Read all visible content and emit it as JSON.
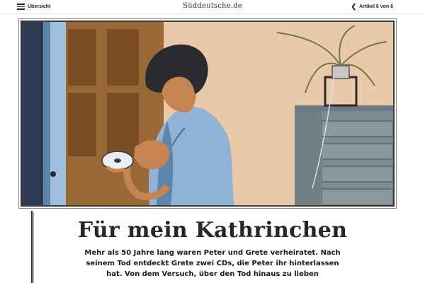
{
  "header": {
    "menu_label": "Übersicht",
    "menu_icon": "hamburger-menu-icon",
    "brand": "Süddeutsche.de",
    "article_nav_label": "Artikel 6 von 6",
    "article_nav_icon": "chevron-left-icon"
  },
  "article": {
    "headline": "Für mein Kathrinchen",
    "teaser": "Mehr als 50 Jahre lang waren Peter und Grete verheiratet. Nach seinem Tod entdeckt Grete zwei CDs, die Peter ihr hinterlassen hat. Von dem Versuch, über den Tod hinaus zu lieben"
  },
  "colors": {
    "wall": "#e9c9a8",
    "door_brown": "#8a5a2c",
    "door_blue": "#9cc0dd",
    "shirt_blue": "#8fb3d4",
    "dresser_grey": "#7f8b92",
    "hair": "#2a2a2e"
  }
}
